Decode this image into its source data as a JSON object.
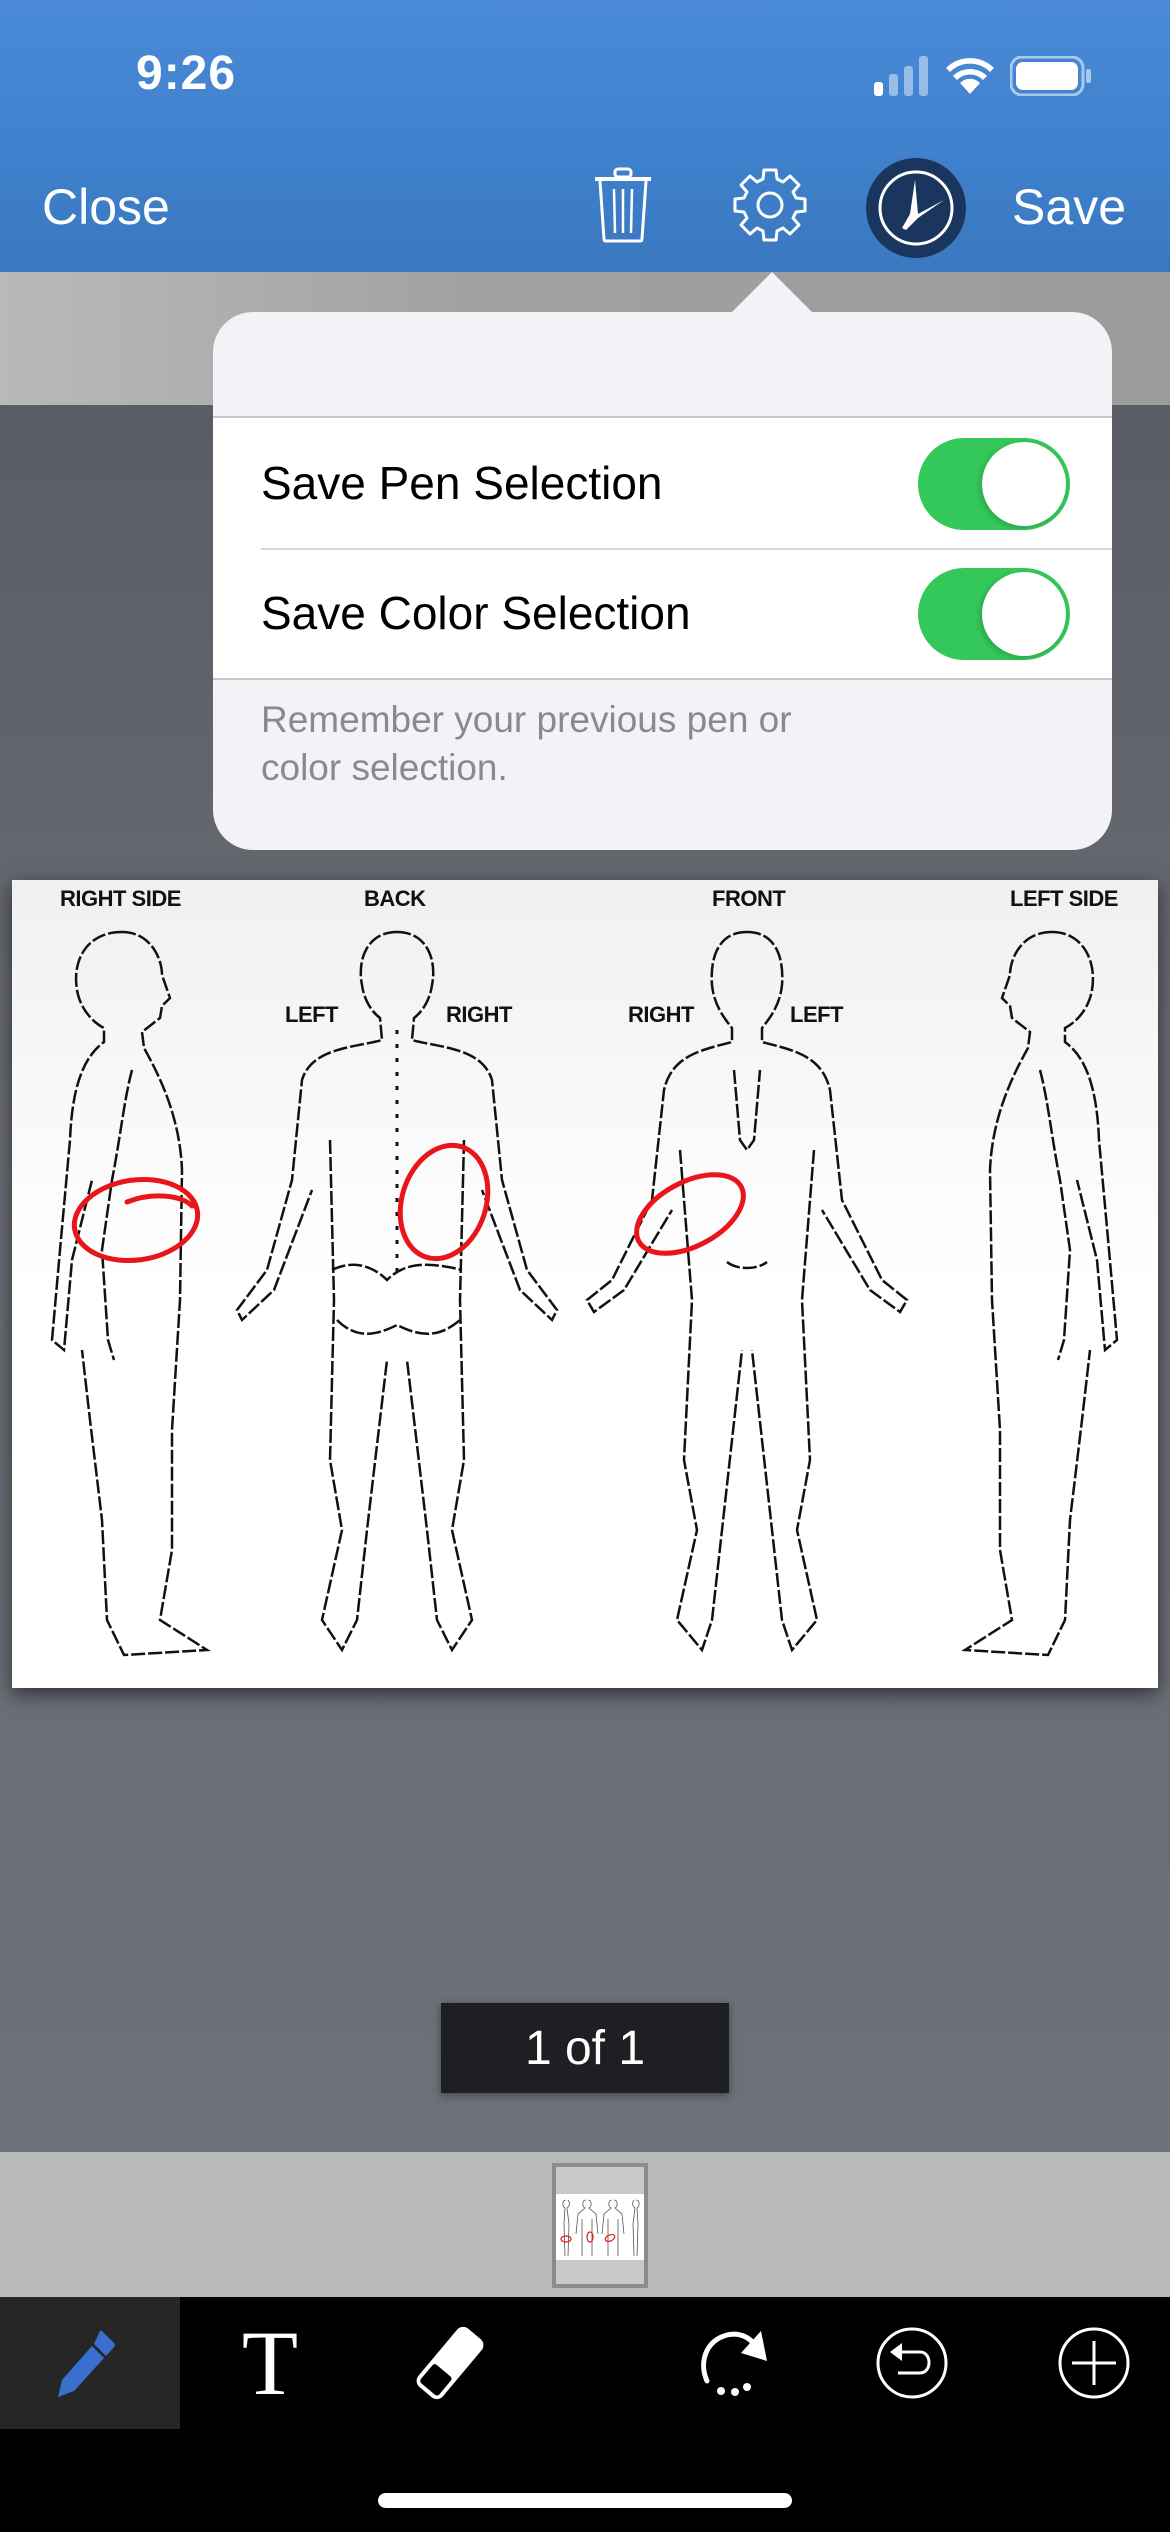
{
  "status_bar": {
    "time": "9:26",
    "icons": [
      "cellular-signal-icon",
      "wifi-icon",
      "battery-icon"
    ]
  },
  "nav": {
    "close_label": "Close",
    "save_label": "Save",
    "icons": [
      "trash-icon",
      "gear-icon",
      "pen-mode-icon"
    ]
  },
  "settings_popover": {
    "rows": [
      {
        "label": "Save Pen Selection",
        "enabled": true
      },
      {
        "label": "Save Color Selection",
        "enabled": true
      }
    ],
    "footer": "Remember your previous pen or color selection.",
    "toggle_color": "#34c759"
  },
  "document": {
    "views": [
      {
        "label": "RIGHT SIDE"
      },
      {
        "label": "BACK"
      },
      {
        "label": "FRONT"
      },
      {
        "label": "LEFT SIDE"
      }
    ],
    "side_labels": {
      "back_left": "LEFT",
      "back_right": "RIGHT",
      "front_right": "RIGHT",
      "front_left": "LEFT"
    },
    "annotation_color": "#e8151b",
    "annotations_count": 3
  },
  "pager": {
    "text": "1 of 1"
  },
  "toolbar": {
    "tools": [
      {
        "name": "pen",
        "selected": true,
        "color": "#3a6fd0"
      },
      {
        "name": "text",
        "glyph": "T",
        "selected": false
      },
      {
        "name": "eraser",
        "selected": false
      },
      {
        "name": "redo",
        "selected": false
      },
      {
        "name": "undo",
        "selected": false
      },
      {
        "name": "add",
        "selected": false
      }
    ]
  }
}
